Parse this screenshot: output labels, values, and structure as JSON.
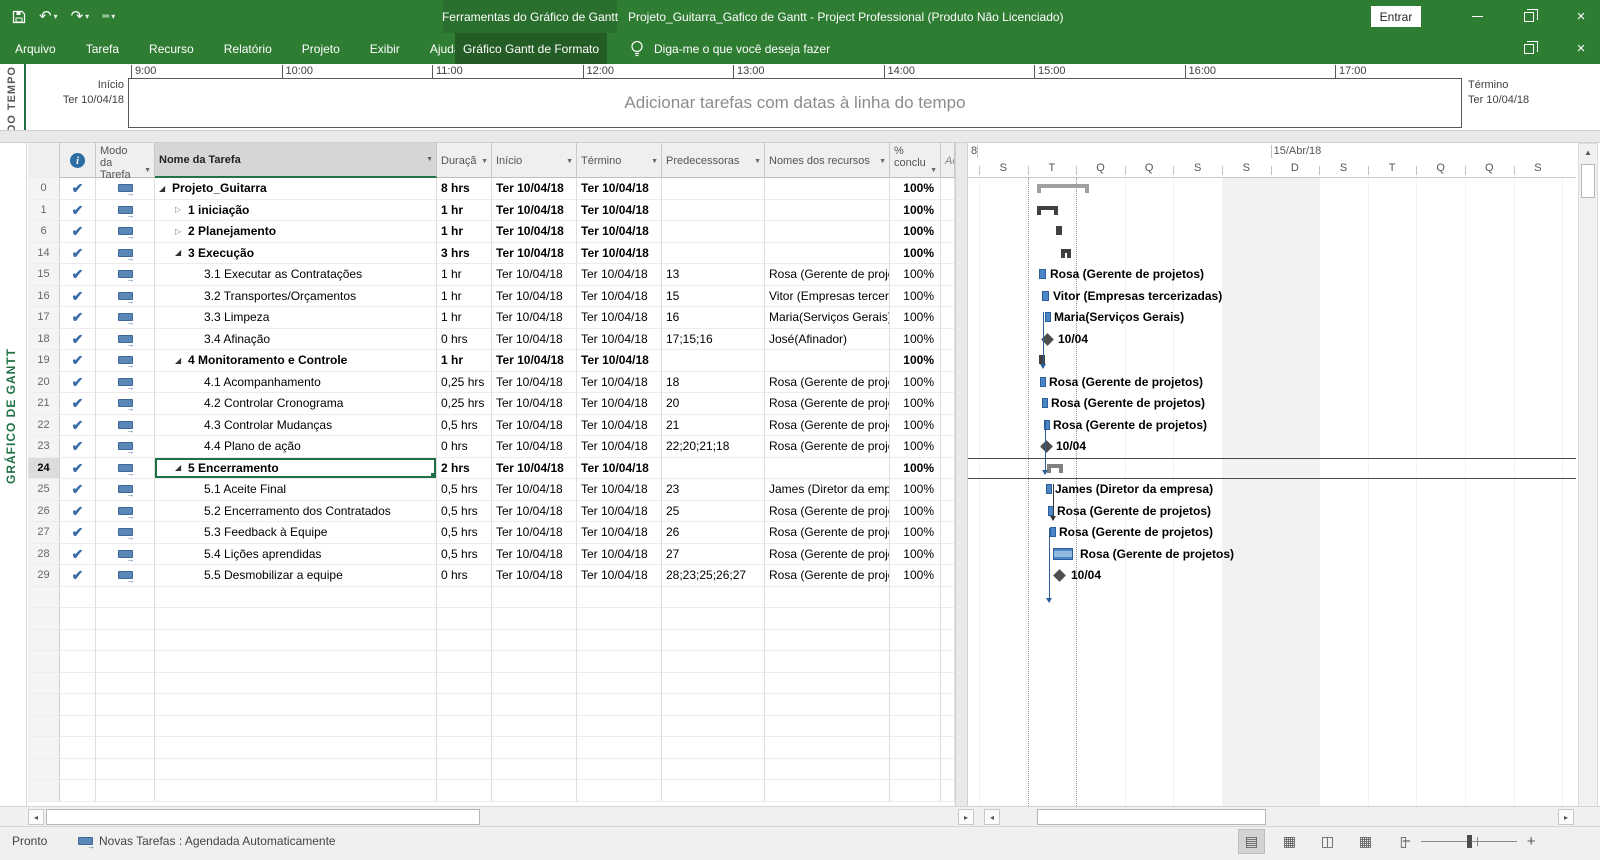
{
  "window": {
    "contextual_group": "Ferramentas do Gráfico de Gantt",
    "title": "Projeto_Guitarra_Gafico de Gantt  -  Project Professional (Produto Não Licenciado)",
    "sign_in": "Entrar"
  },
  "ribbon": {
    "tabs": [
      "Arquivo",
      "Tarefa",
      "Recurso",
      "Relatório",
      "Projeto",
      "Exibir",
      "Ajuda"
    ],
    "active_tab": "Gráfico Gantt de Formato",
    "tell_me": "Diga-me o que você deseja fazer"
  },
  "timeline": {
    "pane_label": "LINHA DO TEMPO",
    "hours": [
      "9:00",
      "10:00",
      "11:00",
      "12:00",
      "13:00",
      "14:00",
      "15:00",
      "16:00",
      "17:00"
    ],
    "placeholder": "Adicionar tarefas com datas à linha do tempo",
    "start_label": "Início",
    "start_date": "Ter 10/04/18",
    "finish_label": "Término",
    "finish_date": "Ter 10/04/18"
  },
  "view_bar": {
    "label": "GRÁFICO DE GANTT"
  },
  "table": {
    "headers": {
      "mode": "Modo da Tarefa",
      "name": "Nome da Tarefa",
      "duration": "Duraçã",
      "start": "Início",
      "finish": "Término",
      "predecessors": "Predecessoras",
      "resources": "Nomes dos recursos",
      "percent": "% conclu",
      "add_column": "Ad"
    },
    "rows": [
      {
        "id": "0",
        "name": "Projeto_Guitarra",
        "indent": 0,
        "toggle": "exp",
        "bold": true,
        "duration": "8 hrs",
        "start": "Ter 10/04/18",
        "finish": "Ter 10/04/18",
        "predecessors": "",
        "resources": "",
        "percent": "100%",
        "gantt": {
          "type": "project",
          "label": ""
        }
      },
      {
        "id": "1",
        "name": "1 iniciação",
        "indent": 1,
        "toggle": "col",
        "bold": true,
        "duration": "1 hr",
        "start": "Ter 10/04/18",
        "finish": "Ter 10/04/18",
        "predecessors": "",
        "resources": "",
        "percent": "100%",
        "gantt": {
          "type": "sum",
          "label": ""
        }
      },
      {
        "id": "6",
        "name": "2 Planejamento",
        "indent": 1,
        "toggle": "col",
        "bold": true,
        "duration": "1 hr",
        "start": "Ter 10/04/18",
        "finish": "Ter 10/04/18",
        "predecessors": "",
        "resources": "",
        "percent": "100%",
        "gantt": {
          "type": "dot",
          "label": ""
        }
      },
      {
        "id": "14",
        "name": "3 Execução",
        "indent": 1,
        "toggle": "exp",
        "bold": true,
        "duration": "3 hrs",
        "start": "Ter 10/04/18",
        "finish": "Ter 10/04/18",
        "predecessors": "",
        "resources": "",
        "percent": "100%",
        "gantt": {
          "type": "sum",
          "label": ""
        }
      },
      {
        "id": "15",
        "name": "3.1 Executar as Contratações",
        "indent": 2,
        "toggle": "",
        "bold": false,
        "duration": "1 hr",
        "start": "Ter 10/04/18",
        "finish": "Ter 10/04/18",
        "predecessors": "13",
        "resources": "Rosa (Gerente de projetos)",
        "percent": "100%",
        "gantt": {
          "type": "bar",
          "label": "Rosa (Gerente de projetos)"
        }
      },
      {
        "id": "16",
        "name": "3.2 Transportes/Orçamentos",
        "indent": 2,
        "toggle": "",
        "bold": false,
        "duration": "1 hr",
        "start": "Ter 10/04/18",
        "finish": "Ter 10/04/18",
        "predecessors": "15",
        "resources": "Vitor (Empresas tercerizadas)",
        "percent": "100%",
        "gantt": {
          "type": "bar",
          "label": "Vitor (Empresas tercerizadas)"
        }
      },
      {
        "id": "17",
        "name": "3.3 Limpeza",
        "indent": 2,
        "toggle": "",
        "bold": false,
        "duration": "1 hr",
        "start": "Ter 10/04/18",
        "finish": "Ter 10/04/18",
        "predecessors": "16",
        "resources": "Maria(Serviços Gerais)",
        "percent": "100%",
        "gantt": {
          "type": "bar",
          "label": "Maria(Serviços Gerais)"
        }
      },
      {
        "id": "18",
        "name": "3.4 Afinação",
        "indent": 2,
        "toggle": "",
        "bold": false,
        "duration": "0 hrs",
        "start": "Ter 10/04/18",
        "finish": "Ter 10/04/18",
        "predecessors": "17;15;16",
        "resources": "José(Afinador)",
        "percent": "100%",
        "gantt": {
          "type": "mile",
          "label": "10/04"
        }
      },
      {
        "id": "19",
        "name": "4 Monitoramento e Controle",
        "indent": 1,
        "toggle": "exp",
        "bold": true,
        "duration": "1 hr",
        "start": "Ter 10/04/18",
        "finish": "Ter 10/04/18",
        "predecessors": "",
        "resources": "",
        "percent": "100%",
        "gantt": {
          "type": "dot",
          "label": ""
        }
      },
      {
        "id": "20",
        "name": "4.1 Acompanhamento",
        "indent": 2,
        "toggle": "",
        "bold": false,
        "duration": "0,25 hrs",
        "start": "Ter 10/04/18",
        "finish": "Ter 10/04/18",
        "predecessors": "18",
        "resources": "Rosa (Gerente de projetos)",
        "percent": "100%",
        "gantt": {
          "type": "bar",
          "label": "Rosa (Gerente de projetos)"
        }
      },
      {
        "id": "21",
        "name": "4.2 Controlar Cronograma",
        "indent": 2,
        "toggle": "",
        "bold": false,
        "duration": "0,25 hrs",
        "start": "Ter 10/04/18",
        "finish": "Ter 10/04/18",
        "predecessors": "20",
        "resources": "Rosa (Gerente de projetos)",
        "percent": "100%",
        "gantt": {
          "type": "bar",
          "label": "Rosa (Gerente de projetos)"
        }
      },
      {
        "id": "22",
        "name": "4.3 Controlar Mudanças",
        "indent": 2,
        "toggle": "",
        "bold": false,
        "duration": "0,5 hrs",
        "start": "Ter 10/04/18",
        "finish": "Ter 10/04/18",
        "predecessors": "21",
        "resources": "Rosa (Gerente de projetos)",
        "percent": "100%",
        "gantt": {
          "type": "bar",
          "label": "Rosa (Gerente de projetos)"
        }
      },
      {
        "id": "23",
        "name": "4.4 Plano de ação",
        "indent": 2,
        "toggle": "",
        "bold": false,
        "duration": "0 hrs",
        "start": "Ter 10/04/18",
        "finish": "Ter 10/04/18",
        "predecessors": "22;20;21;18",
        "resources": "Rosa (Gerente de projetos)",
        "percent": "100%",
        "gantt": {
          "type": "mile",
          "label": "10/04"
        }
      },
      {
        "id": "24",
        "name": "5 Encerramento",
        "indent": 1,
        "toggle": "exp",
        "bold": true,
        "selected": true,
        "duration": "2 hrs",
        "start": "Ter 10/04/18",
        "finish": "Ter 10/04/18",
        "predecessors": "",
        "resources": "",
        "percent": "100%",
        "gantt": {
          "type": "sumsel",
          "label": ""
        }
      },
      {
        "id": "25",
        "name": "5.1 Aceite Final",
        "indent": 2,
        "toggle": "",
        "bold": false,
        "duration": "0,5 hrs",
        "start": "Ter 10/04/18",
        "finish": "Ter 10/04/18",
        "predecessors": "23",
        "resources": "James (Diretor da empresa)",
        "percent": "100%",
        "gantt": {
          "type": "bar",
          "label": "James (Diretor da empresa)"
        }
      },
      {
        "id": "26",
        "name": "5.2 Encerramento dos Contratados",
        "indent": 2,
        "toggle": "",
        "bold": false,
        "duration": "0,5 hrs",
        "start": "Ter 10/04/18",
        "finish": "Ter 10/04/18",
        "predecessors": "25",
        "resources": "Rosa (Gerente de projetos)",
        "percent": "100%",
        "gantt": {
          "type": "bar",
          "label": "Rosa (Gerente de projetos)"
        }
      },
      {
        "id": "27",
        "name": "5.3 Feedback à Equipe",
        "indent": 2,
        "toggle": "",
        "bold": false,
        "duration": "0,5 hrs",
        "start": "Ter 10/04/18",
        "finish": "Ter 10/04/18",
        "predecessors": "26",
        "resources": "Rosa (Gerente de projetos)",
        "percent": "100%",
        "gantt": {
          "type": "bar",
          "label": "Rosa (Gerente de projetos)"
        }
      },
      {
        "id": "28",
        "name": "5.4 Lições aprendidas",
        "indent": 2,
        "toggle": "",
        "bold": false,
        "duration": "0,5 hrs",
        "start": "Ter 10/04/18",
        "finish": "Ter 10/04/18",
        "predecessors": "27",
        "resources": "Rosa (Gerente de projetos)",
        "percent": "100%",
        "gantt": {
          "type": "barsel",
          "label": "Rosa (Gerente de projetos)"
        }
      },
      {
        "id": "29",
        "name": "5.5 Desmobilizar a equipe",
        "indent": 2,
        "toggle": "",
        "bold": false,
        "duration": "0 hrs",
        "start": "Ter 10/04/18",
        "finish": "Ter 10/04/18",
        "predecessors": "28;23;25;26;27",
        "resources": "Rosa (Gerente de projetos)",
        "percent": "100%",
        "gantt": {
          "type": "mile",
          "label": "10/04"
        }
      }
    ]
  },
  "chart": {
    "week_labels": [
      "8",
      "15/Abr/18"
    ],
    "day_letters": [
      "S",
      "T",
      "Q",
      "Q",
      "S",
      "S",
      "D",
      "S",
      "T",
      "Q",
      "Q",
      "S"
    ]
  },
  "status_bar": {
    "ready": "Pronto",
    "new_tasks": "Novas Tarefas : Agendada Automaticamente"
  },
  "colors": {
    "accent_green": "#2e7d33",
    "selection_green": "#1e7145",
    "bar_blue": "#4a86c8"
  }
}
